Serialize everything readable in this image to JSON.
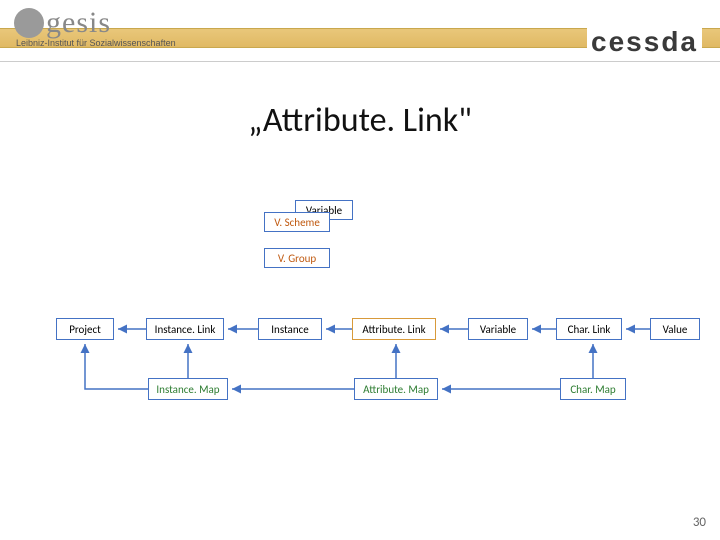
{
  "header": {
    "logo_left_word": "gesis",
    "logo_left_sub": "Leibniz-Institut für Sozialwissenschaften",
    "logo_right": "cessda"
  },
  "title": "„Attribute. Link\"",
  "diagram": {
    "top_stack": {
      "variable": "Variable",
      "vscheme": "V. Scheme",
      "vgroup": "V. Group"
    },
    "main_row": {
      "project": "Project",
      "instance_link": "Instance. Link",
      "instance": "Instance",
      "attribute_link": "Attribute. Link",
      "variable": "Variable",
      "char_link": "Char. Link",
      "value": "Value"
    },
    "bottom_row": {
      "instance_map": "Instance. Map",
      "attribute_map": "Attribute. Map",
      "char_map": "Char. Map"
    }
  },
  "page_number": "30",
  "colors": {
    "box_border": "#4472c4",
    "orange_border": "#d89a3a",
    "orange_text": "#c05a11",
    "green_text": "#2e7d32"
  }
}
